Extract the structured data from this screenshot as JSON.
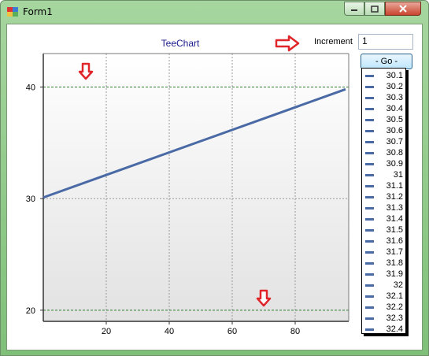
{
  "window": {
    "title": "Form1"
  },
  "controls": {
    "increment_label": "Increment",
    "increment_value": "1",
    "go_label": "- Go -"
  },
  "colors": {
    "series": "#4a6aa5",
    "arrow": "#e0262a",
    "marker_line": "#2e7d32"
  },
  "chart_data": {
    "type": "line",
    "title": "TeeChart",
    "x": [
      0,
      96
    ],
    "series": [
      {
        "values": [
          30.1,
          39.8
        ]
      }
    ],
    "ylim": [
      19,
      43
    ],
    "xlim": [
      0,
      97
    ],
    "yticks": [
      20,
      30,
      40
    ],
    "xticks": [
      20,
      40,
      60,
      80
    ],
    "horizontal_lines": [
      20,
      40
    ],
    "legend": [
      "30.1",
      "30.2",
      "30.3",
      "30.4",
      "30.5",
      "30.6",
      "30.7",
      "30.8",
      "30.9",
      "31",
      "31.1",
      "31.2",
      "31.3",
      "31.4",
      "31.5",
      "31.6",
      "31.7",
      "31.8",
      "31.9",
      "32",
      "32.1",
      "32.2",
      "32.3",
      "32.4"
    ],
    "grid": true,
    "legend_position": "right"
  }
}
